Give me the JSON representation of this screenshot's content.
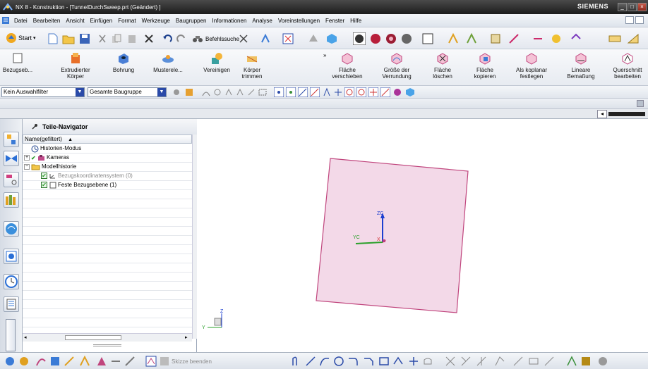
{
  "window": {
    "title": "NX 8 - Konstruktion - [TunnelDurchSweep.prt (Geändert) ]",
    "brand": "SIEMENS",
    "controls": [
      "_",
      "□",
      "×"
    ]
  },
  "menubar": {
    "items": [
      {
        "label": "Datei"
      },
      {
        "label": "Bearbeiten"
      },
      {
        "label": "Ansicht"
      },
      {
        "label": "Einfügen"
      },
      {
        "label": "Format"
      },
      {
        "label": "Werkzeuge"
      },
      {
        "label": "Baugruppen"
      },
      {
        "label": "Informationen"
      },
      {
        "label": "Analyse"
      },
      {
        "label": "Voreinstellungen"
      },
      {
        "label": "Fenster"
      },
      {
        "label": "Hilfe"
      }
    ]
  },
  "standard_toolbar": {
    "start_label": "Start",
    "command_finder_label": "Befehlssuche"
  },
  "feature_toolbar": {
    "left_buttons": [
      {
        "label": "Bezugseb...",
        "icon": "datum-plane-icon"
      },
      {
        "label": "Extrudierter Körper",
        "icon": "extrude-icon"
      },
      {
        "label": "Bohrung",
        "icon": "hole-icon"
      },
      {
        "label": "Musterele...",
        "icon": "pattern-icon"
      },
      {
        "label": "Vereinigen",
        "icon": "unite-icon"
      },
      {
        "label": "Körper trimmen",
        "icon": "trim-body-icon"
      }
    ],
    "right_buttons": [
      {
        "label": "Fläche verschieben",
        "icon": "move-face-icon"
      },
      {
        "label": "Größe der Verrundung",
        "icon": "blend-size-icon"
      },
      {
        "label": "Fläche löschen",
        "icon": "delete-face-icon"
      },
      {
        "label": "Fläche kopieren",
        "icon": "copy-face-icon"
      },
      {
        "label": "Als koplanar festlegen",
        "icon": "coplanar-icon"
      },
      {
        "label": "Lineare Bemaßung",
        "icon": "linear-dimension-icon"
      },
      {
        "label": "Querschnitt bearbeiten",
        "icon": "edit-section-icon"
      }
    ]
  },
  "selection_bar": {
    "filter_value": "Kein Auswahlfilter",
    "scope_value": "Gesamte Baugruppe"
  },
  "part_navigator": {
    "title": "Teile-Navigator",
    "column_header": "Name(gefiltert)",
    "sort_indicator": "▲",
    "rows": [
      {
        "label": "Historien-Modus",
        "level": 0,
        "icon": "clock-icon",
        "checked": false,
        "expander": ""
      },
      {
        "label": "Kameras",
        "level": 0,
        "icon": "camera-icon",
        "checked": true,
        "expander": "+"
      },
      {
        "label": "Modellhistorie",
        "level": 0,
        "icon": "folder-icon",
        "checked": false,
        "expander": "−"
      },
      {
        "label": "Bezugskoordinatensystem (0)",
        "level": 1,
        "icon": "csys-icon",
        "checked": true,
        "expander": "",
        "dimmed": true
      },
      {
        "label": "Feste Bezugsebene (1)",
        "level": 1,
        "icon": "datum-plane-icon",
        "checked": true,
        "expander": "",
        "dimmed": false
      }
    ]
  },
  "viewport": {
    "triad_labels": {
      "x": "X",
      "y": "YC",
      "z": "ZC"
    },
    "mini_triad_labels": {
      "y": "Y",
      "z": "Z"
    },
    "plane_color": "#f3d9e8",
    "plane_edge_color": "#c0457d"
  },
  "bottom_toolbar": {
    "finish_sketch_label": "Skizze beenden"
  },
  "colors": {
    "titlebar": "#2b2b2b",
    "accent_blue": "#2a4aa8",
    "toolbar_bg": "#e7ebf1"
  }
}
